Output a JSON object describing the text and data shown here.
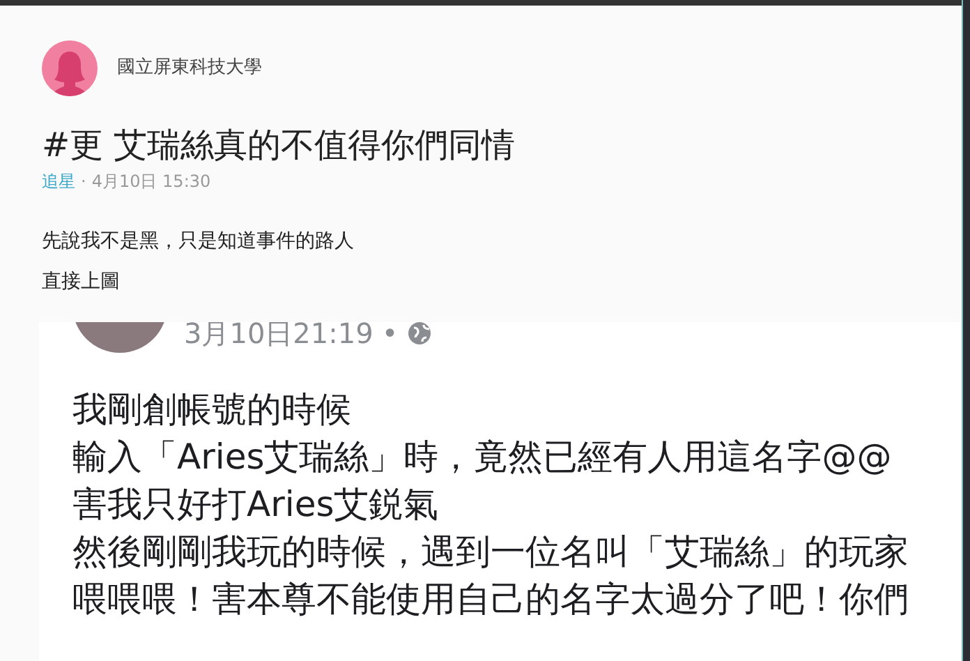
{
  "author": {
    "name": "國立屏東科技大學"
  },
  "post": {
    "title": "#更 艾瑞絲真的不值得你們同情",
    "board": "追星",
    "separator": "·",
    "time": "4月10日 15:30",
    "body": [
      "先說我不是黑，只是知道事件的路人",
      "直接上圖"
    ]
  },
  "embedded_screenshot": {
    "time": "3月10日21:19",
    "separator": "•",
    "lines": [
      "我剛創帳號的時候",
      "輸入「Aries艾瑞絲」時，竟然已經有人用這名字@@",
      "害我只好打Aries艾鋭氣",
      "然後剛剛我玩的時候，遇到一位名叫「艾瑞絲」的玩家",
      "喂喂喂！害本尊不能使用自己的名字太過分了吧！你們"
    ]
  }
}
